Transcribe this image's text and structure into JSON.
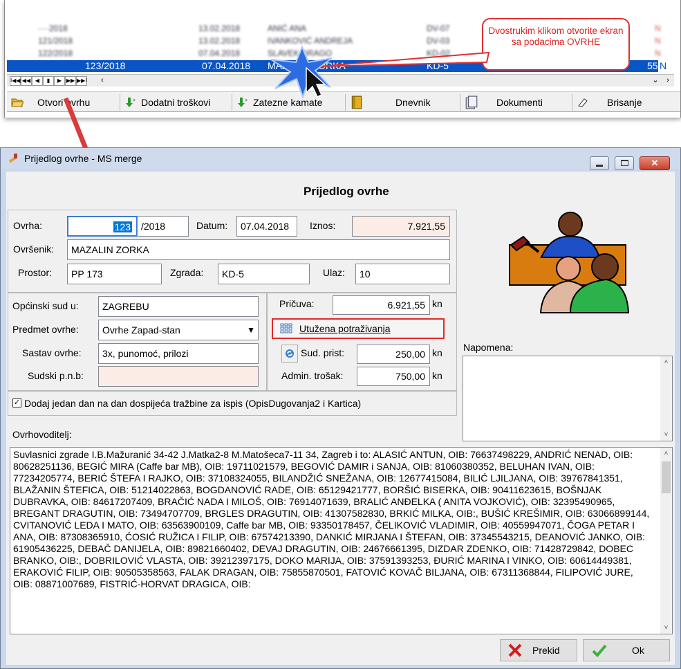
{
  "grid": {
    "selected_row": {
      "number": "123/2018",
      "date": "07.04.2018",
      "debtor": "MAZALIN ZORKA",
      "building": "KD-5",
      "amount_tail": "55",
      "flag": "N"
    }
  },
  "toolbar": {
    "open_label": "Otvori ovrhu",
    "extra_costs_label": "Dodatni troškovi",
    "late_interest_label": "Zatezne kamate",
    "diary_label": "Dnevnik",
    "documents_label": "Dokumenti",
    "delete_label": "Brisanje"
  },
  "callout": {
    "text": "Dvostrukim klikom otvorite ekran sa podacima OVRHE"
  },
  "dialog": {
    "window_title": "Prijedlog ovrhe - MS merge",
    "heading": "Prijedlog ovrhe",
    "labels": {
      "ovrha": "Ovrha:",
      "datum": "Datum:",
      "iznos": "Iznos:",
      "ovrsenik": "Ovršenik:",
      "prostor": "Prostor:",
      "zgrada": "Zgrada:",
      "ulaz": "Ulaz:",
      "opcinski_sud": "Općinski sud u:",
      "predmet_ovrhe": "Predmet ovrhe:",
      "sastav_ovrhe": "Sastav ovrhe:",
      "sudski_pnb": "Sudski p.n.b:",
      "pricuva": "Pričuva:",
      "sud_prist": "Sud. prist:",
      "admin_trosak": "Admin. trošak:",
      "kn": "kn",
      "napomena": "Napomena:",
      "ovrhovoditelj": "Ovrhovoditelj:"
    },
    "values": {
      "ovrha_number": "123",
      "ovrha_year": "/2018",
      "datum": "07.04.2018",
      "iznos": "7.921,55",
      "ovrsenik": "MAZALIN ZORKA",
      "prostor": "PP 173",
      "zgrada": "KD-5",
      "ulaz": "10",
      "opcinski_sud": "ZAGREBU",
      "predmet_ovrhe": "Ovrhe Zapad-stan",
      "sastav_ovrhe": "3x, punomoć, prilozi",
      "sudski_pnb": "",
      "pricuva": "6.921,55",
      "sud_prist": "250,00",
      "admin_trosak": "750,00"
    },
    "utuzena_label": "Utužena potraživanja",
    "checkbox_label": "Dodaj jedan dan na dan dospijeća tražbine za ispis (OpisDugovanja2 i Kartica)",
    "ovrhovoditelj_text": "Suvlasnici zgrade I.B.Mažuranić 34-42 J.Matka2-8 M.Matošeca7-11 34, Zagreb i to: ALASIĆ ANTUN, OIB: 76637498229, ANDRIĆ NENAD, OIB: 80628251136, BEGIĆ MIRA (Caffe bar MB), OIB: 19711021579, BEGOVIĆ DAMIR i SANJA, OIB: 81060380352, BELUHAN IVAN, OIB: 77234205774, BERIĆ ŠTEFA I RAJKO, OIB: 37108324055, BILANDŽIĆ SNEŽANA, OIB: 12677415084, BILIĆ LJILJANA, OIB: 39767841351, BLAŽANIN ŠTEFICA, OIB: 51214022863, BOGDANOVIĆ RADE, OIB: 65129421777, BORŠIĆ BISERKA, OIB: 90411623615, BOŠNJAK DUBRAVKA, OIB: 84617207409, BRAČIĆ NADA I MILOŠ, OIB: 76914071639, BRALIĆ ANĐELKA ( ANITA VOJKOVIĆ), OIB: 32395490965, BREGANT DRAGUTIN, OIB: 73494707709, BRGLES DRAGUTIN, OIB: 41307582830, BRKIĆ MILKA, OIB:, BUŠIĆ KREŠIMIR, OIB: 63066899144, CVITANOVIĆ LEDA I MATO, OIB: 63563900109, Caffe bar MB, OIB: 93350178457, ČELIKOVIĆ VLADIMIR, OIB: 40559947071, ČOGA PETAR I ANA, OIB: 87308365910, ĆOSIĆ RUŽICA I FILIP, OIB: 67574213390, DANKIĆ MIRJANA I ŠTEFAN, OIB: 37345543215, DEANOVIĆ JANKO, OIB: 61905436225, DEBAČ DANIJELA, OIB: 89821660402, DEVAJ DRAGUTIN, OIB: 24676661395, DIZDAR ZDENKO, OIB: 71428729842, DOBEC BRANKO, OIB:, DOBRILOVIĆ VLASTA, OIB: 39212397175, DOKO MARIJA, OIB: 37591393253, ĐURIĆ MARINA I VINKO, OIB: 60614449381, ERAKOVIĆ FILIP, OIB: 90505358563, FALAK DRAGAN, OIB: 75855870501, FATOVIĆ KOVAČ BILJANA, OIB: 67311368844, FILIPOVIĆ JURE, OIB: 08871007689, FISTRIĆ-HORVAT DRAGICA, OIB:",
    "buttons": {
      "prekid": "Prekid",
      "ok": "Ok"
    }
  },
  "colors": {
    "selection": "#0a55c6",
    "callout": "#e03030",
    "dialog_frame": "#c9d8ec"
  }
}
